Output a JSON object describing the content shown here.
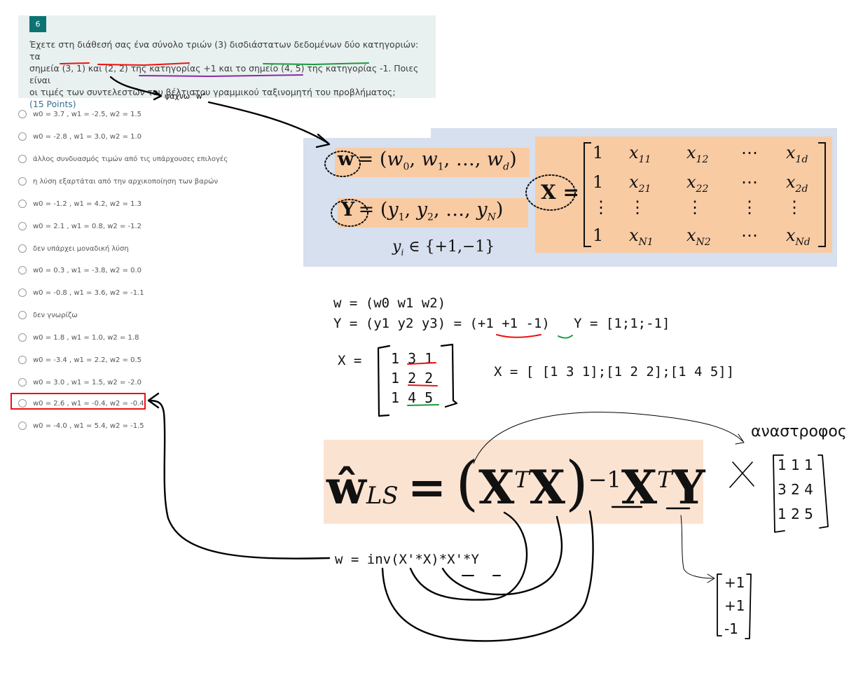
{
  "question": {
    "number": "6",
    "line1": "Έχετε στη διάθεσή σας ένα σύνολο τριών (3) δισδιάστατων δεδομένων δύο κατηγοριών:  τα",
    "line2": "σημεία (3, 1) και (2, 2) της κατηγορίας +1 και το σημείο (4, 5) της κατηγορίας -1. Ποιες είναι",
    "line3": "οι τιμές των συντελεστών του βέλτιστου γραμμικού ταξινομητή του προβλήματος;",
    "points": "(15 Points)"
  },
  "options": [
    "w0 = 3.7 , w1 = -2.5, w2 = 1.5",
    "w0 = -2.8 , w1 = 3.0, w2 = 1.0",
    "άλλος συνδυασμός τιμών από τις υπάρχουσες επιλογές",
    "η λύση εξαρτάται από την αρχικοποίηση των βαρών",
    "w0 = -1.2 , w1 = 4.2, w2 = 1.3",
    "w0 = 2.1 , w1 = 0.8, w2 = -1.2",
    "δεν υπάρχει μοναδική λύση",
    "w0 = 0.3 , w1 = -3.8, w2 = 0.0",
    "w0 = -0.8 , w1 = 3.6, w2 = -1.1",
    "δεν γνωρίζω",
    "w0 = 1.8 , w1 = 1.0, w2 = 1.8",
    "w0 = -3.4 , w1 = 2.2, w2 = 0.5",
    "w0 = 3.0 , w1 = 1.5, w2 = -2.0",
    "w0 = 2.6 , w1 = -0.4, w2 = -0.4",
    "w0 = -4.0 , w1 = 5.4, w2 = -1.5"
  ],
  "annotations": {
    "search_note": "ψαχνω \"w\"",
    "transpose_note": "αναστροφος",
    "code_w": "w = (w0 w1 w2)",
    "code_y": "Y = (y1 y2 y3) = (+1 +1 -1)   Y = [1;1;-1]",
    "code_x_label": "X =",
    "code_x_matlab": "X = [ [1 3 1];[1 2 2];[1 4 5]]",
    "code_solution": "w = inv(X'*X)*X'*Y",
    "matrix_x_rows": [
      "1 3 1",
      "1 2 2",
      "1 4 5"
    ],
    "matrix_xt_rows": [
      "1 1 1",
      "3 2 4",
      "1 2 5"
    ],
    "vector_y_rows": [
      "+1",
      "+1",
      "-1"
    ]
  },
  "math": {
    "w_def": "w = (w₀, w₁, …, w_d)",
    "y_def": "Y = (y₁, y₂, …, y_N)",
    "y_domain": "yᵢ ∈ {+1,−1}",
    "x_matrix": [
      [
        "1",
        "x11",
        "x12",
        "⋯",
        "x1d"
      ],
      [
        "1",
        "x21",
        "x22",
        "⋯",
        "x2d"
      ],
      [
        "⋮",
        "⋮",
        "⋮",
        "⋮",
        "⋮"
      ],
      [
        "1",
        "xN1",
        "xN2",
        "⋯",
        "xNd"
      ]
    ],
    "ls_formula": "ŵLS = (XᵀX)⁻¹XᵀY"
  }
}
